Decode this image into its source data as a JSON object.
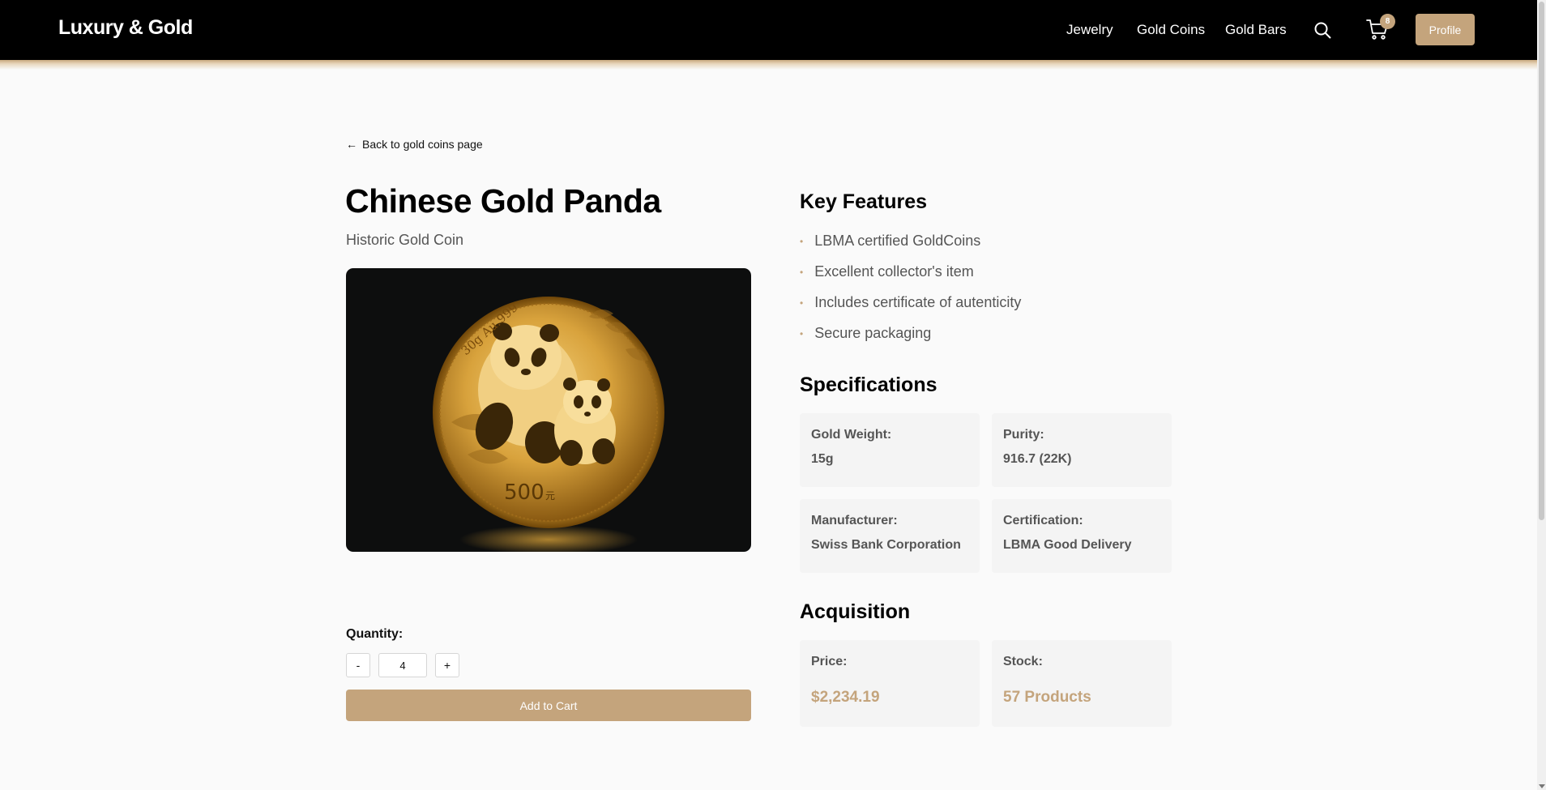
{
  "nav": {
    "brand": "Luxury & Gold",
    "links": [
      "Jewelry",
      "Gold Coins",
      "Gold Bars"
    ],
    "cart_count": "8",
    "profile_label": "Profile"
  },
  "back_link": "Back to gold coins page",
  "product": {
    "title": "Chinese Gold Panda",
    "subtitle": "Historic Gold Coin",
    "image": {
      "coin_top_text": "30g Au.999",
      "coin_value_text": "500",
      "coin_unit_text": "元"
    }
  },
  "quantity": {
    "label": "Quantity:",
    "minus": "-",
    "plus": "+",
    "value": "4"
  },
  "add_to_cart": "Add to Cart",
  "key_features": {
    "title": "Key Features",
    "items": [
      "LBMA certified GoldCoins",
      "Excellent collector's item",
      "Includes certificate of autenticity",
      "Secure packaging"
    ]
  },
  "specifications": {
    "title": "Specifications",
    "items": [
      {
        "label": "Gold Weight:",
        "value": "15g"
      },
      {
        "label": "Purity:",
        "value": "916.7 (22K)"
      },
      {
        "label": "Manufacturer:",
        "value": "Swiss Bank Corporation"
      },
      {
        "label": "Certification:",
        "value": "LBMA Good Delivery"
      }
    ]
  },
  "acquisition": {
    "title": "Acquisition",
    "price_label": "Price:",
    "price_value": "$2,234.19",
    "stock_label": "Stock:",
    "stock_value": "57 Products"
  },
  "colors": {
    "accent": "#c4a47c",
    "navbar": "#000000",
    "background": "#fafafa"
  },
  "icons": [
    "search-icon",
    "cart-icon",
    "arrow-left-icon",
    "bullet-dot-icon"
  ]
}
